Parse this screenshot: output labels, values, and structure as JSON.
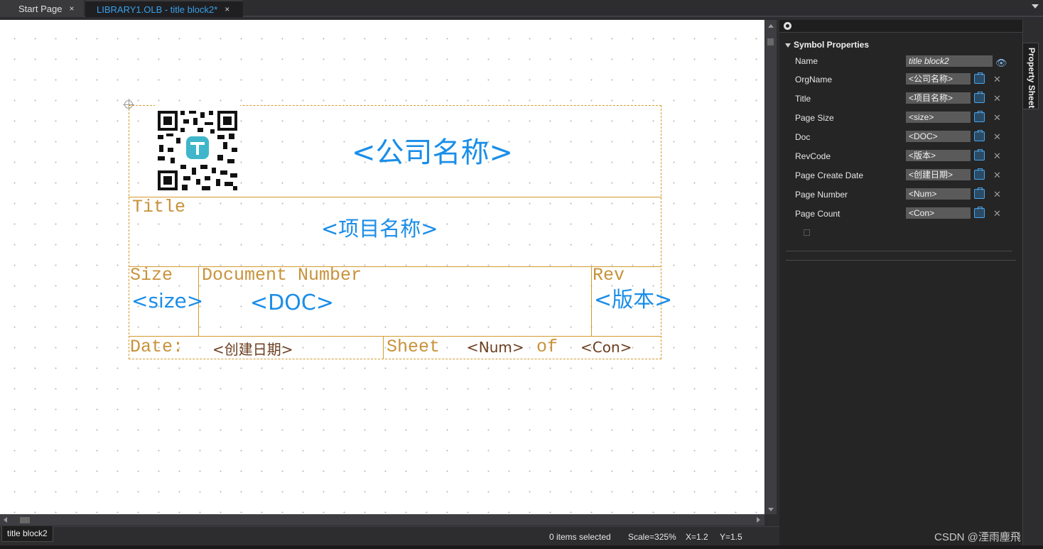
{
  "tabs": [
    {
      "label": "Start Page",
      "close": "×"
    },
    {
      "label": "LIBRARY1.OLB - title block2*",
      "close": "×"
    }
  ],
  "title_block": {
    "org_name": "<公司名称>",
    "title_label": "Title",
    "title_value": "<项目名称>",
    "size_label": "Size",
    "size_value": "<size>",
    "doc_label": "Document Number",
    "doc_value": "<DOC>",
    "rev_label": "Rev",
    "rev_value": "<版本>",
    "date_label": "Date:",
    "date_value": "<创建日期>",
    "sheet_label": "Sheet",
    "num_value": "<Num>",
    "of_label": "of",
    "count_value": "<Con>"
  },
  "properties": {
    "section_title": "Symbol Properties",
    "rows": [
      {
        "label": "Name",
        "value": "title block2"
      },
      {
        "label": "OrgName",
        "value": "<公司名称>"
      },
      {
        "label": "Title",
        "value": "<项目名称>"
      },
      {
        "label": "Page Size",
        "value": "<size>"
      },
      {
        "label": "Doc",
        "value": "<DOC>"
      },
      {
        "label": "RevCode",
        "value": "<版本>"
      },
      {
        "label": "Page Create Date",
        "value": "<创建日期>"
      },
      {
        "label": "Page Number",
        "value": "<Num>"
      },
      {
        "label": "Page Count",
        "value": "<Con>"
      }
    ],
    "delete_glyph": "✕",
    "eye_glyph": "👁"
  },
  "side_tab": {
    "label": "Property Sheet"
  },
  "status": {
    "page_tab": "title block2",
    "selected": "0 items selected",
    "scale": "Scale=325%",
    "x": "X=1.2",
    "y": "Y=1.5"
  },
  "watermark": "CSDN @湮雨塵飛",
  "icons": [
    "close-icon",
    "dropdown-arrow-icon",
    "pin-icon",
    "collapse-triangle-icon",
    "eye-icon",
    "edit-icon",
    "delete-icon",
    "add-property-icon",
    "origin-marker-icon",
    "qr-code-icon"
  ],
  "colors": {
    "accent_blue": "#1a8ee8",
    "frame_orange": "#d29a2e",
    "label_brown": "#6b3e1f"
  }
}
